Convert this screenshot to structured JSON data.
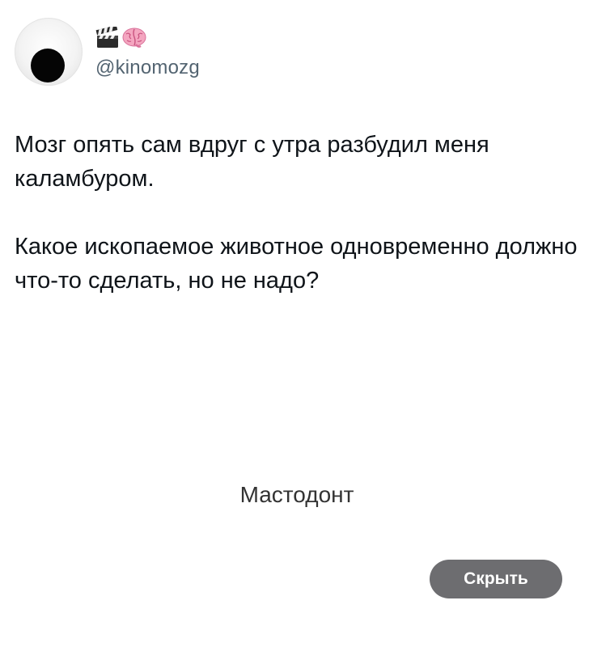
{
  "author": {
    "handle": "@kinomozg",
    "emoji": [
      "clapper-board",
      "brain"
    ]
  },
  "tweet": {
    "paragraph1": "Мозг опять сам вдруг с утра разбудил меня каламбуром.",
    "paragraph2": "Какое ископаемое животное одновременно должно что-то сделать, но не надо?"
  },
  "answer": {
    "text": "Мастодонт"
  },
  "hide_button": {
    "label": "Скрыть"
  },
  "colors": {
    "text": "#0f1419",
    "handle": "#536471",
    "answer": "#333333",
    "button_bg": "#6d6d70",
    "button_text": "#ffffff"
  }
}
